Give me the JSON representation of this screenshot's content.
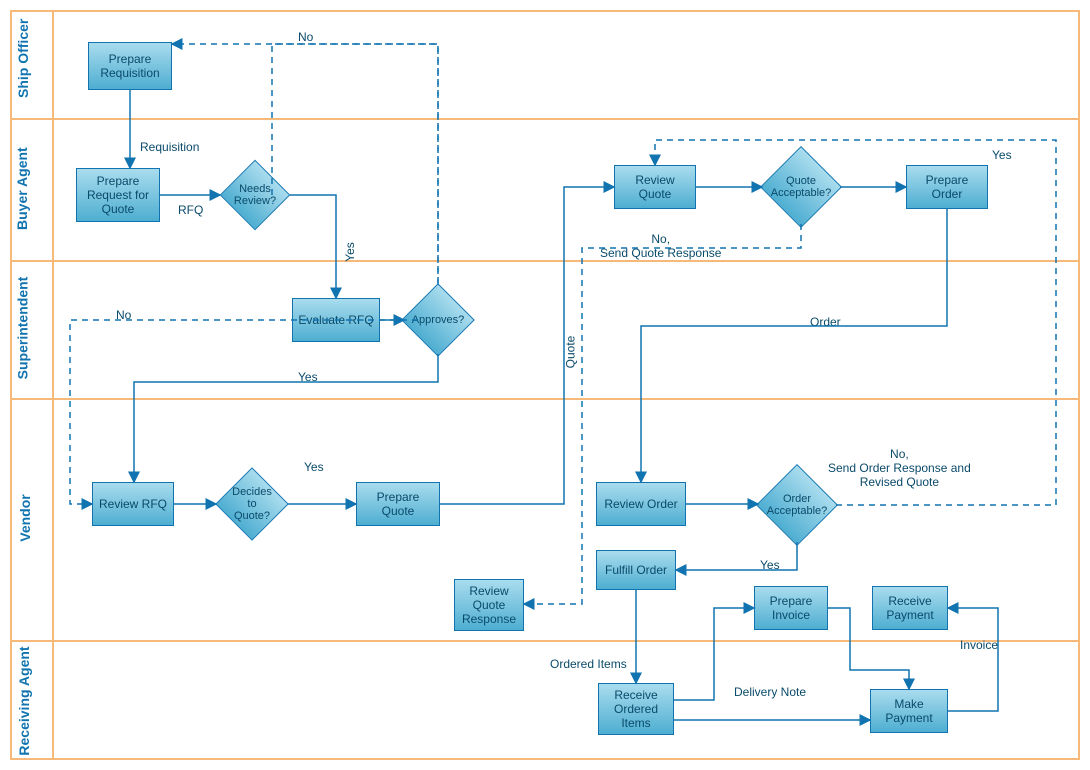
{
  "lanes": [
    "Ship Officer",
    "Buyer Agent",
    "Superintendent",
    "Vendor",
    "Receiving Agent"
  ],
  "nodes": {
    "prepReq": "Prepare Requisition",
    "prepRFQ": "Prepare Request for Quote",
    "needsReview": "Needs Review?",
    "evalRFQ": "Evaluate RFQ",
    "approves": "Approves?",
    "reviewRFQ": "Review RFQ",
    "decidesQuote": "Decides to Quote?",
    "prepQuote": "Prepare Quote",
    "reviewQuote": "Review Quote",
    "quoteAcc": "Quote Acceptable?",
    "prepOrder": "Prepare Order",
    "reviewQResp": "Review Quote Response",
    "reviewOrder": "Review Order",
    "orderAcc": "Order Acceptable?",
    "fulfill": "Fulfill Order",
    "prepInv": "Prepare Invoice",
    "recvPay": "Receive Payment",
    "recvItems": "Receive Ordered Items",
    "makePay": "Make Payment"
  },
  "edges": {
    "req": "Requisition",
    "rfq": "RFQ",
    "yes1": "Yes",
    "no1": "No",
    "yes2": "Yes",
    "no2": "No",
    "yes3": "Yes",
    "quote": "Quote",
    "yes4": "Yes",
    "noSendQ": "No,\nSend Quote Response",
    "order": "Order",
    "noSendO": "No,\nSend Order Response and\nRevised Quote",
    "yes5": "Yes",
    "ordItems": "Ordered Items",
    "delivNote": "Delivery Note",
    "invoice": "Invoice"
  }
}
